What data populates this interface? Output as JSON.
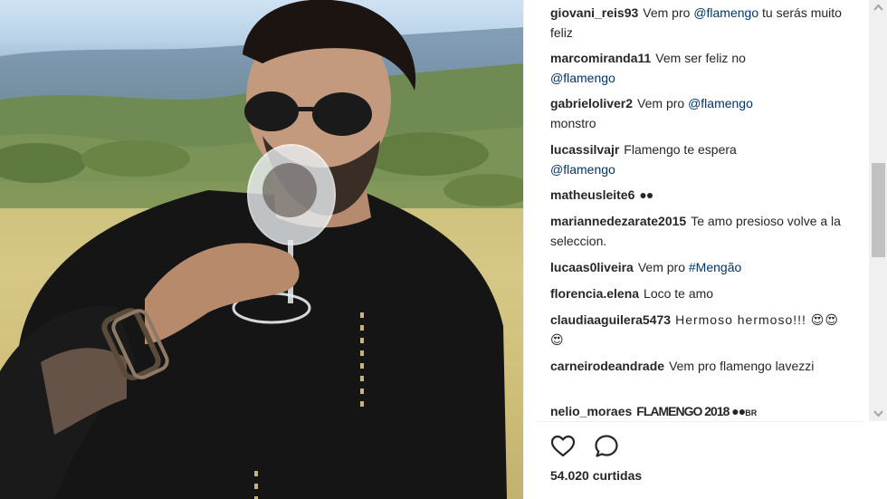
{
  "post": {
    "likes": "54.020 curtidas"
  },
  "comments": [
    {
      "user": "giovani_reis93",
      "text": "Vem pro ",
      "mention": "@flamengo",
      "after": " tu serás muito feliz"
    },
    {
      "user": "marcomiranda11",
      "text": "Vem ser feliz no ",
      "mention": "@flamengo",
      "after": ""
    },
    {
      "user": "gabrieloliver2",
      "text": "Vem pro ",
      "mention": "@flamengo",
      "after": " monstro"
    },
    {
      "user": "lucassilvajr",
      "text": "Flamengo te espera ",
      "mention": "@flamengo",
      "after": ""
    },
    {
      "user": "matheusleite6",
      "text": "●●",
      "mention": "",
      "after": ""
    },
    {
      "user": "mariannedezarate2015",
      "text": "Te amo presioso volve a la seleccion.",
      "mention": "",
      "after": ""
    },
    {
      "user": "lucaas0liveira",
      "text": "Vem pro ",
      "mention": "#Mengão",
      "after": ""
    },
    {
      "user": "florencia.elena",
      "text": "Loco te amo",
      "mention": "",
      "after": ""
    },
    {
      "user": "claudiaaguilera5473",
      "text": "Hermoso hermoso!!! 😍😍😍",
      "mention": "",
      "after": ""
    },
    {
      "user": "carneirodeandrade",
      "text": "Vem pro flamengo lavezzi",
      "mention": "",
      "after": ""
    },
    {
      "user": "nelio_moraes",
      "text": "FLAMENGO 2018 ●●",
      "mention": "",
      "after": "BR"
    }
  ],
  "icons": {
    "like": "heart-icon",
    "comment": "speech-bubble-icon"
  },
  "colors": {
    "text": "#262626",
    "mention": "#003569",
    "border": "#efefef"
  }
}
